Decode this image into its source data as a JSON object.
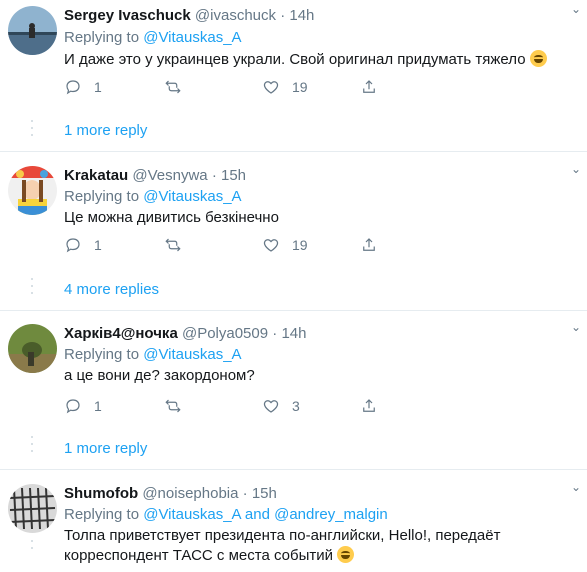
{
  "tweets": [
    {
      "name": "Sergey Ivaschuck",
      "handle": "@ivaschuck",
      "time": "14h",
      "replying_label": "Replying to",
      "replying_to": "@Vitauskas_A",
      "text": "И даже это у украинцев украли. Свой оригинал придумать тяжело",
      "emoji": "rolling-on-floor-laughing",
      "reply_count": "1",
      "retweet_count": "",
      "like_count": "19",
      "more_replies": "1 more reply"
    },
    {
      "name": "Krakatau",
      "handle": "@Vesnywa",
      "time": "15h",
      "replying_label": "Replying to",
      "replying_to": "@Vitauskas_A",
      "text": "Це можна дивитись безкінечно",
      "reply_count": "1",
      "retweet_count": "",
      "like_count": "19",
      "more_replies": "4 more replies"
    },
    {
      "name": "Харків4@ночка",
      "handle": "@Polya0509",
      "time": "14h",
      "replying_label": "Replying to",
      "replying_to": "@Vitauskas_A",
      "text": "а це вони де? закордоном?",
      "reply_count": "1",
      "retweet_count": "",
      "like_count": "3",
      "more_replies": "1 more reply"
    },
    {
      "name": "Shumofob",
      "handle": "@noisephobia",
      "time": "15h",
      "replying_label": "Replying to",
      "replying_to": "@Vitauskas_A",
      "replying_and": "and",
      "replying_to_2": "@andrey_malgin",
      "text_line1": "Толпа приветствует президента по-английски, Hello!, передаёт",
      "text_line2": "корреспондент ТАСС с места событий",
      "emoji": "face-with-tears-of-joy"
    }
  ],
  "dot_separator": "·",
  "icons": {
    "reply": "reply-icon",
    "retweet": "retweet-icon",
    "like": "heart-icon",
    "share": "share-icon",
    "more": "chevron-down-icon"
  },
  "colors": {
    "link": "#1da1f2",
    "secondary": "#657786",
    "separator": "#e6ecf0"
  }
}
